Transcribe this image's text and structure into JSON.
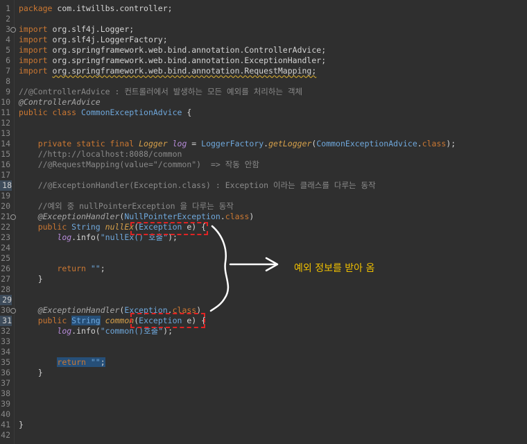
{
  "editor": {
    "lines": [
      {
        "num": "1",
        "parts": [
          {
            "c": "kw",
            "t": "package "
          },
          {
            "c": "pl",
            "t": "com.itwillbs.controller;"
          }
        ]
      },
      {
        "num": "2",
        "parts": []
      },
      {
        "num": "3",
        "fold": true,
        "parts": [
          {
            "c": "kw",
            "t": "import "
          },
          {
            "c": "pl",
            "t": "org.slf4j.Logger;"
          }
        ]
      },
      {
        "num": "4",
        "parts": [
          {
            "c": "kw",
            "t": "import "
          },
          {
            "c": "pl",
            "t": "org.slf4j.LoggerFactory;"
          }
        ]
      },
      {
        "num": "5",
        "parts": [
          {
            "c": "kw",
            "t": "import "
          },
          {
            "c": "pl",
            "t": "org.springframework.web.bind.annotation.ControllerAdvice;"
          }
        ]
      },
      {
        "num": "6",
        "parts": [
          {
            "c": "kw",
            "t": "import "
          },
          {
            "c": "pl",
            "t": "org.springframework.web.bind.annotation.ExceptionHandler;"
          }
        ]
      },
      {
        "num": "7",
        "parts": [
          {
            "c": "kw",
            "t": "import "
          },
          {
            "c": "pl squig",
            "t": "org.springframework.web.bind.annotation.RequestMapping;"
          }
        ]
      },
      {
        "num": "8",
        "parts": []
      },
      {
        "num": "9",
        "parts": [
          {
            "c": "cm",
            "t": "//@ControllerAdvice : 컨트롤러에서 발생하는 모든 예외를 처리하는 객체"
          }
        ]
      },
      {
        "num": "10",
        "parts": [
          {
            "c": "an",
            "t": "@ControllerAdvice"
          }
        ]
      },
      {
        "num": "11",
        "parts": [
          {
            "c": "kw",
            "t": "public class "
          },
          {
            "c": "ty",
            "t": "CommonExceptionAdvice"
          },
          {
            "c": "pl",
            "t": " {"
          }
        ]
      },
      {
        "num": "12",
        "parts": []
      },
      {
        "num": "13",
        "parts": []
      },
      {
        "num": "14",
        "parts": [
          {
            "c": "pl",
            "t": "    "
          },
          {
            "c": "kw",
            "t": "private static final "
          },
          {
            "c": "fn",
            "t": "Logger"
          },
          {
            "c": "pl",
            "t": " "
          },
          {
            "c": "field",
            "t": "log"
          },
          {
            "c": "pl",
            "t": " = "
          },
          {
            "c": "ty",
            "t": "LoggerFactory"
          },
          {
            "c": "pl",
            "t": "."
          },
          {
            "c": "fn",
            "t": "getLogger"
          },
          {
            "c": "pl",
            "t": "("
          },
          {
            "c": "ty",
            "t": "CommonExceptionAdvice"
          },
          {
            "c": "pl",
            "t": "."
          },
          {
            "c": "kw",
            "t": "class"
          },
          {
            "c": "pl",
            "t": ");"
          }
        ]
      },
      {
        "num": "15",
        "parts": [
          {
            "c": "pl",
            "t": "    "
          },
          {
            "c": "cm",
            "t": "//http://localhost:8088/common"
          }
        ]
      },
      {
        "num": "16",
        "parts": [
          {
            "c": "pl",
            "t": "    "
          },
          {
            "c": "cm",
            "t": "//@RequestMapping(value=\"/common\")  => 작동 안함"
          }
        ]
      },
      {
        "num": "17",
        "parts": []
      },
      {
        "num": "18",
        "marked": true,
        "parts": [
          {
            "c": "pl",
            "t": "    "
          },
          {
            "c": "cm",
            "t": "//@ExceptionHandler(Exception.class) : Exception 이라는 클래스를 다루는 동작"
          }
        ]
      },
      {
        "num": "19",
        "parts": []
      },
      {
        "num": "20",
        "parts": [
          {
            "c": "pl",
            "t": "    "
          },
          {
            "c": "cm",
            "t": "//예외 중 nullPointerException 을 다루는 동작"
          }
        ]
      },
      {
        "num": "21",
        "fold": true,
        "parts": [
          {
            "c": "pl",
            "t": "    "
          },
          {
            "c": "an",
            "t": "@ExceptionHandler"
          },
          {
            "c": "pl",
            "t": "("
          },
          {
            "c": "ty",
            "t": "NullPointerException"
          },
          {
            "c": "pl",
            "t": "."
          },
          {
            "c": "kw",
            "t": "class"
          },
          {
            "c": "pl",
            "t": ")"
          }
        ]
      },
      {
        "num": "22",
        "parts": [
          {
            "c": "pl",
            "t": "    "
          },
          {
            "c": "kw",
            "t": "public "
          },
          {
            "c": "ty",
            "t": "String"
          },
          {
            "c": "pl",
            "t": " "
          },
          {
            "c": "fn",
            "t": "nullEx"
          },
          {
            "c": "pl",
            "t": "("
          },
          {
            "c": "ty",
            "t": "Exception"
          },
          {
            "c": "pl",
            "t": " e) {"
          }
        ]
      },
      {
        "num": "23",
        "parts": [
          {
            "c": "pl",
            "t": "        "
          },
          {
            "c": "field",
            "t": "log"
          },
          {
            "c": "pl",
            "t": "."
          },
          {
            "c": "pl",
            "t": "info("
          },
          {
            "c": "st",
            "t": "\"nullEx() 호출\""
          },
          {
            "c": "pl",
            "t": ");"
          }
        ]
      },
      {
        "num": "24",
        "parts": []
      },
      {
        "num": "25",
        "parts": []
      },
      {
        "num": "26",
        "parts": [
          {
            "c": "pl",
            "t": "        "
          },
          {
            "c": "kw",
            "t": "return "
          },
          {
            "c": "st",
            "t": "\"\""
          },
          {
            "c": "pl",
            "t": ";"
          }
        ]
      },
      {
        "num": "27",
        "parts": [
          {
            "c": "pl",
            "t": "    }"
          }
        ]
      },
      {
        "num": "28",
        "parts": []
      },
      {
        "num": "29",
        "marked": true,
        "parts": []
      },
      {
        "num": "30",
        "fold": true,
        "parts": [
          {
            "c": "pl",
            "t": "    "
          },
          {
            "c": "an",
            "t": "@ExceptionHandler"
          },
          {
            "c": "pl",
            "t": "("
          },
          {
            "c": "ty",
            "t": "Exception"
          },
          {
            "c": "pl",
            "t": "."
          },
          {
            "c": "kw",
            "t": "class"
          },
          {
            "c": "pl",
            "t": ")"
          }
        ]
      },
      {
        "num": "31",
        "marked": true,
        "parts": [
          {
            "c": "pl",
            "t": "    "
          },
          {
            "c": "kw",
            "t": "public "
          },
          {
            "c": "ty sel",
            "t": "String"
          },
          {
            "c": "pl",
            "t": " "
          },
          {
            "c": "fn",
            "t": "common"
          },
          {
            "c": "pl",
            "t": "("
          },
          {
            "c": "ty",
            "t": "Exception"
          },
          {
            "c": "pl",
            "t": " e) {"
          }
        ]
      },
      {
        "num": "32",
        "parts": [
          {
            "c": "pl",
            "t": "        "
          },
          {
            "c": "field",
            "t": "log"
          },
          {
            "c": "pl",
            "t": "."
          },
          {
            "c": "pl",
            "t": "info("
          },
          {
            "c": "st",
            "t": "\"common()호출\""
          },
          {
            "c": "pl",
            "t": ");"
          }
        ]
      },
      {
        "num": "33",
        "parts": []
      },
      {
        "num": "34",
        "parts": []
      },
      {
        "num": "35",
        "parts": [
          {
            "c": "pl",
            "t": "        "
          },
          {
            "c": "kw sel",
            "t": "return "
          },
          {
            "c": "st sel",
            "t": "\"\""
          },
          {
            "c": "pl sel",
            "t": ";"
          }
        ]
      },
      {
        "num": "36",
        "parts": [
          {
            "c": "pl",
            "t": "    }"
          }
        ]
      },
      {
        "num": "37",
        "parts": []
      },
      {
        "num": "38",
        "parts": []
      },
      {
        "num": "39",
        "parts": []
      },
      {
        "num": "40",
        "parts": []
      },
      {
        "num": "41",
        "parts": [
          {
            "c": "pl",
            "t": "}"
          }
        ]
      },
      {
        "num": "42",
        "parts": []
      }
    ]
  },
  "annotation": {
    "text": "예외 정보를 받아 옴"
  },
  "colors": {
    "background": "#2f2f2f",
    "highlight_box": "#e02424",
    "annotation": "#f0c000"
  }
}
